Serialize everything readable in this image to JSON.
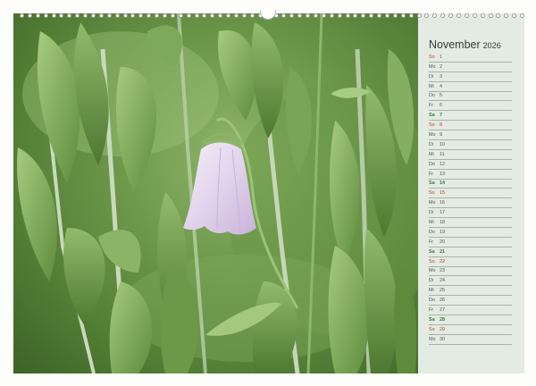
{
  "calendar": {
    "month": "November",
    "year": "2026",
    "days": [
      {
        "wd": "So",
        "d": "1",
        "t": "sun"
      },
      {
        "wd": "Mo",
        "d": "2",
        "t": ""
      },
      {
        "wd": "Di",
        "d": "3",
        "t": ""
      },
      {
        "wd": "Mi",
        "d": "4",
        "t": ""
      },
      {
        "wd": "Do",
        "d": "5",
        "t": ""
      },
      {
        "wd": "Fr",
        "d": "6",
        "t": ""
      },
      {
        "wd": "Sa",
        "d": "7",
        "t": "sat"
      },
      {
        "wd": "So",
        "d": "8",
        "t": "sun"
      },
      {
        "wd": "Mo",
        "d": "9",
        "t": ""
      },
      {
        "wd": "Di",
        "d": "10",
        "t": ""
      },
      {
        "wd": "Mi",
        "d": "11",
        "t": ""
      },
      {
        "wd": "Do",
        "d": "12",
        "t": ""
      },
      {
        "wd": "Fr",
        "d": "13",
        "t": ""
      },
      {
        "wd": "Sa",
        "d": "14",
        "t": "sat"
      },
      {
        "wd": "So",
        "d": "15",
        "t": "sun"
      },
      {
        "wd": "Mo",
        "d": "16",
        "t": ""
      },
      {
        "wd": "Di",
        "d": "17",
        "t": ""
      },
      {
        "wd": "Mi",
        "d": "18",
        "t": ""
      },
      {
        "wd": "Do",
        "d": "19",
        "t": ""
      },
      {
        "wd": "Fr",
        "d": "20",
        "t": ""
      },
      {
        "wd": "Sa",
        "d": "21",
        "t": "sat"
      },
      {
        "wd": "So",
        "d": "22",
        "t": "sun"
      },
      {
        "wd": "Mo",
        "d": "23",
        "t": ""
      },
      {
        "wd": "Di",
        "d": "24",
        "t": ""
      },
      {
        "wd": "Mi",
        "d": "25",
        "t": ""
      },
      {
        "wd": "Do",
        "d": "26",
        "t": ""
      },
      {
        "wd": "Fr",
        "d": "27",
        "t": ""
      },
      {
        "wd": "Sa",
        "d": "28",
        "t": "sat"
      },
      {
        "wd": "So",
        "d": "29",
        "t": "sun"
      },
      {
        "wd": "Mo",
        "d": "30",
        "t": ""
      }
    ]
  },
  "colors": {
    "panel": "#e3ebe2",
    "sunday": "#c0392b",
    "saturday": "#3c7a3c",
    "flower": "#e6d8ee"
  }
}
